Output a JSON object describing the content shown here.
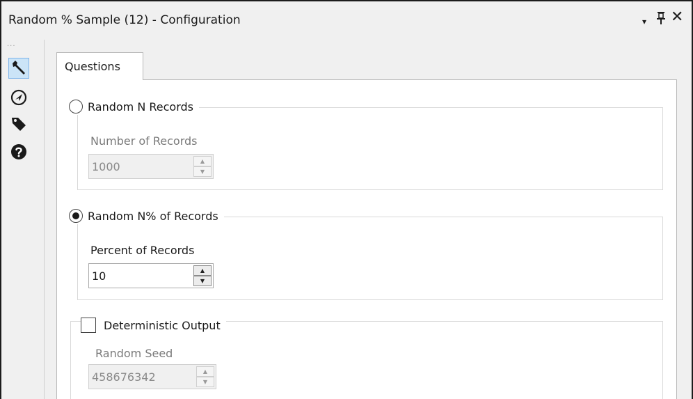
{
  "window": {
    "title": "Random % Sample (12) - Configuration",
    "dropdown_glyph": "▾",
    "pin_glyph": "📌",
    "close_glyph": "✕"
  },
  "toolbar": {
    "grip": "···",
    "items": [
      {
        "name": "wrench-icon",
        "active": true
      },
      {
        "name": "navigation-icon",
        "active": false
      },
      {
        "name": "tag-icon",
        "active": false
      },
      {
        "name": "help-icon",
        "active": false
      }
    ]
  },
  "tabs": [
    {
      "label": "Questions"
    }
  ],
  "options": {
    "random_n": {
      "label": "Random N Records",
      "selected": false,
      "field_label": "Number of Records",
      "value": "1000",
      "enabled": false
    },
    "random_percent": {
      "label": "Random N% of Records",
      "selected": true,
      "field_label": "Percent of Records",
      "value": "10",
      "enabled": true
    },
    "deterministic": {
      "label": "Deterministic Output",
      "checked": false,
      "field_label": "Random Seed",
      "value": "458676342",
      "enabled": false
    }
  },
  "spin_glyphs": {
    "up": "▲",
    "down": "▼"
  },
  "colors": {
    "active_tool_bg": "#cbe4f7",
    "active_tool_border": "#7eb4ea",
    "disabled_text": "#7a7a7a"
  }
}
